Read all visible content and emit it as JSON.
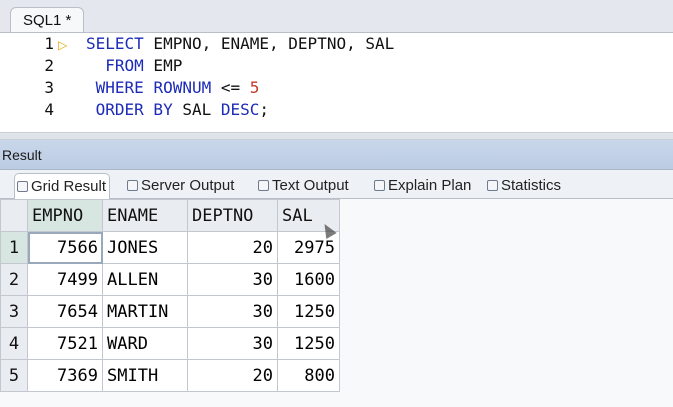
{
  "editor": {
    "tab_label": "SQL1 *",
    "line_numbers": [
      "1",
      "2",
      "3",
      "4"
    ],
    "lines": [
      [
        {
          "t": "SELECT",
          "c": "kw"
        },
        {
          "t": " EMPNO, ENAME, DEPTNO, SAL",
          "c": ""
        }
      ],
      [
        {
          "t": "  FROM",
          "c": "kw"
        },
        {
          "t": " EMP",
          "c": ""
        }
      ],
      [
        {
          "t": " WHERE",
          "c": "kw"
        },
        {
          "t": " ",
          "c": ""
        },
        {
          "t": "ROWNUM",
          "c": "kw"
        },
        {
          "t": " <= ",
          "c": ""
        },
        {
          "t": "5",
          "c": "num"
        }
      ],
      [
        {
          "t": " ORDER BY",
          "c": "kw"
        },
        {
          "t": " SAL ",
          "c": ""
        },
        {
          "t": "DESC",
          "c": "kw"
        },
        {
          "t": ";",
          "c": ""
        }
      ]
    ],
    "run_marker_icon": "current-line-arrow-icon"
  },
  "result_panel": {
    "title": "Result",
    "tabs": [
      {
        "label": "Grid Result",
        "icon": "grid-icon",
        "active": true
      },
      {
        "label": "Server Output",
        "icon": "server-icon",
        "active": false
      },
      {
        "label": "Text Output",
        "icon": "text-icon",
        "active": false
      },
      {
        "label": "Explain Plan",
        "icon": "plan-icon",
        "active": false
      },
      {
        "label": "Statistics",
        "icon": "statistics-icon",
        "active": false
      }
    ]
  },
  "grid": {
    "columns": [
      "EMPNO",
      "ENAME",
      "DEPTNO",
      "SAL"
    ],
    "rows": [
      {
        "rn": "1",
        "cells": [
          "7566",
          "JONES",
          "20",
          "2975"
        ]
      },
      {
        "rn": "2",
        "cells": [
          "7499",
          "ALLEN",
          "30",
          "1600"
        ]
      },
      {
        "rn": "3",
        "cells": [
          "7654",
          "MARTIN",
          "30",
          "1250"
        ]
      },
      {
        "rn": "4",
        "cells": [
          "7521",
          "WARD",
          "30",
          "1250"
        ]
      },
      {
        "rn": "5",
        "cells": [
          "7369",
          "SMITH",
          "20",
          "800"
        ]
      }
    ]
  },
  "colors": {
    "keyword": "#1c2bb8",
    "number": "#c0392b",
    "selection": "#d8e6e1"
  }
}
